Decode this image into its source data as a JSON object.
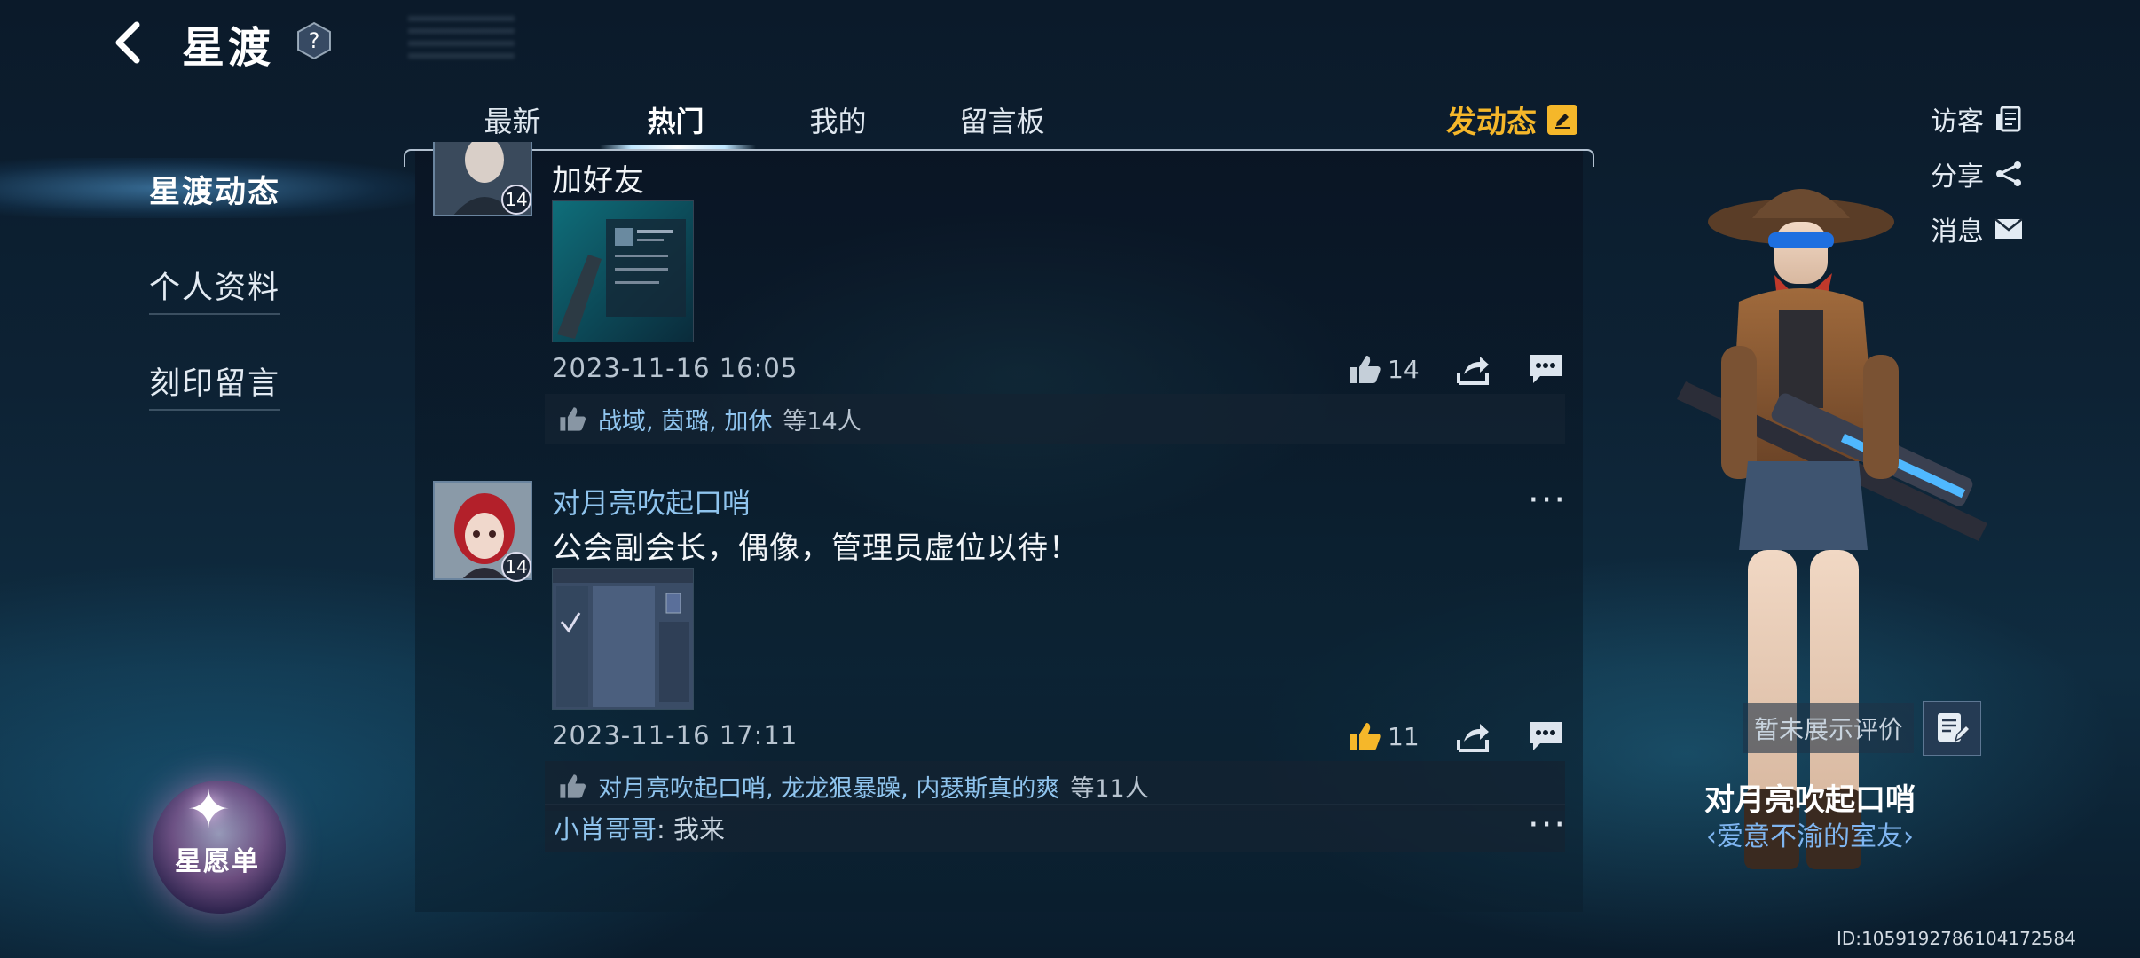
{
  "header": {
    "title": "星渡",
    "help_glyph": "?"
  },
  "tabs": [
    {
      "label": "最新",
      "active": false
    },
    {
      "label": "热门",
      "active": true
    },
    {
      "label": "我的",
      "active": false
    },
    {
      "label": "留言板",
      "active": false
    }
  ],
  "post_button": {
    "label": "发动态"
  },
  "sidebar": {
    "items": [
      {
        "label": "星渡动态",
        "active": true
      },
      {
        "label": "个人资料",
        "active": false
      },
      {
        "label": "刻印留言",
        "active": false
      }
    ],
    "wishlist_label": "星愿单"
  },
  "feed": {
    "posts": [
      {
        "level": "14",
        "text": "加好友",
        "time": "2023-11-16 16:05",
        "like_count": "14",
        "likers": "战域, 茵璐, 加休",
        "likers_more": "等14人"
      },
      {
        "username": "对月亮吹起口哨",
        "level": "14",
        "text": "公会副会长，偶像，管理员虚位以待！",
        "time": "2023-11-16 17:11",
        "like_count": "11",
        "likers": "对月亮吹起口哨, 龙龙狠暴躁, 内瑟斯真的爽",
        "likers_more": "等11人",
        "comment": {
          "author": "小肖哥哥",
          "text": ": 我来"
        }
      }
    ]
  },
  "right_panel": {
    "visitors_label": "访客",
    "share_label": "分享",
    "messages_label": "消息",
    "rating_label": "暂未展示评价",
    "character_name": "对月亮吹起口哨",
    "character_title": "‹爱意不渝的室友›",
    "id_text": "ID:1059192786104172584"
  },
  "colors": {
    "accent_gold": "#f5b72a",
    "link_blue": "#8fc4ee",
    "title_blue": "#7fb5f0",
    "like_active": "#f5b72a"
  },
  "icons": [
    "back-arrow-icon",
    "help-icon",
    "edit-icon",
    "thumbs-up-icon",
    "share-icon",
    "comment-icon",
    "more-icon",
    "visitors-icon",
    "share-nodes-icon",
    "mail-icon",
    "review-icon"
  ]
}
